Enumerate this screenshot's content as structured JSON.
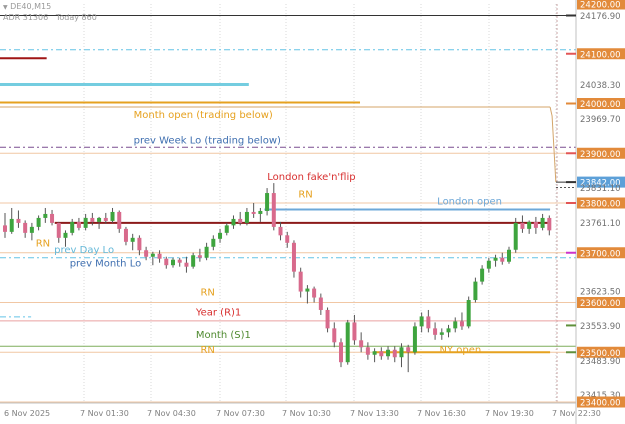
{
  "header": {
    "symbol": "DE40,M15",
    "adr": "ADR 31306",
    "today": "Today 860"
  },
  "colors": {
    "grid": "#d9d9d9",
    "sep": "#c8a6a6",
    "bull": "#3ea43e",
    "bear": "#d86a8c",
    "wick": "#555555",
    "round": "#e9a84b",
    "year": "#d96a6a",
    "month": "#5f8f3a",
    "london": "#6ea8d8",
    "ny": "#e6a11f",
    "weeklo": "#7a4e90",
    "dayblue": "#3f6fb0",
    "axisText": "#707070",
    "labelDefault": "#e28a3a"
  },
  "chart_data": {
    "type": "candlestick",
    "symbol": "DE40",
    "timeframe": "M15",
    "ylim": [
      23400,
      24200
    ],
    "price_labels": [
      {
        "label": "24200.00",
        "v": 24200,
        "bg": "#e28a3a",
        "fg": "#ffffff",
        "tick": ""
      },
      {
        "label": "24176.90",
        "v": 24176.9,
        "bg": "",
        "fg": "#707070",
        "tick": "#333333"
      },
      {
        "label": "24100.00",
        "v": 24100,
        "bg": "#e28a3a",
        "fg": "#ffffff",
        "tick": "#e25555"
      },
      {
        "label": "24038.30",
        "v": 24038.3,
        "bg": "",
        "fg": "#707070",
        "tick": ""
      },
      {
        "label": "24000.00",
        "v": 24000,
        "bg": "#e28a3a",
        "fg": "#ffffff",
        "tick": "#e28a3a"
      },
      {
        "label": "23969.70",
        "v": 23969.7,
        "bg": "",
        "fg": "#707070",
        "tick": ""
      },
      {
        "label": "23900.00",
        "v": 23900,
        "bg": "#e28a3a",
        "fg": "#ffffff",
        "tick": "#e25555"
      },
      {
        "label": "23842.00",
        "v": 23842,
        "bg": "#5da0d8",
        "fg": "#ffffff",
        "tick": "#333333"
      },
      {
        "label": "23831.10",
        "v": 23831.1,
        "bg": "",
        "fg": "#707070",
        "tick": ""
      },
      {
        "label": "23800.00",
        "v": 23800,
        "bg": "#e28a3a",
        "fg": "#ffffff",
        "tick": "#e25555"
      },
      {
        "label": "23761.10",
        "v": 23761.1,
        "bg": "",
        "fg": "#707070",
        "tick": ""
      },
      {
        "label": "23700.00",
        "v": 23700,
        "bg": "#e28a3a",
        "fg": "#ffffff",
        "tick": "#cc33cc"
      },
      {
        "label": "23623.50",
        "v": 23623.5,
        "bg": "",
        "fg": "#707070",
        "tick": ""
      },
      {
        "label": "23600.00",
        "v": 23600,
        "bg": "#e28a3a",
        "fg": "#ffffff",
        "tick": ""
      },
      {
        "label": "23553.90",
        "v": 23553.9,
        "bg": "",
        "fg": "#707070",
        "tick": "#5f8f3a"
      },
      {
        "label": "23500.00",
        "v": 23500,
        "bg": "#e28a3a",
        "fg": "#ffffff",
        "tick": "#5f8f3a"
      },
      {
        "label": "23483.90",
        "v": 23483.9,
        "bg": "",
        "fg": "#707070",
        "tick": ""
      },
      {
        "label": "23415.30",
        "v": 23415.3,
        "bg": "",
        "fg": "#707070",
        "tick": ""
      },
      {
        "label": "23400.00",
        "v": 23400,
        "bg": "#e28a3a",
        "fg": "#ffffff",
        "tick": ""
      }
    ],
    "time_labels": [
      "6 Nov 2025",
      "7 Nov 01:30",
      "7 Nov 04:30",
      "7 Nov 07:30",
      "7 Nov 10:30",
      "7 Nov 13:30",
      "7 Nov 16:30",
      "7 Nov 19:30",
      "7 Nov 22:30"
    ],
    "levels": [
      {
        "name": "24176.90",
        "v": 24176.9,
        "x0": 0.0,
        "x1": 1.0,
        "color": "#333333",
        "dash": "",
        "w": 1
      },
      {
        "name": "blue-dashdot-upper",
        "v": 24108,
        "x0": 0.0,
        "x1": 1.0,
        "color": "#63c3e6",
        "dash": "6,3,2,3",
        "w": 1
      },
      {
        "name": "dark-red-short",
        "v": 24091,
        "x0": 0.0,
        "x1": 0.081,
        "color": "#a01515",
        "dash": "",
        "w": 2
      },
      {
        "name": "cyan-short",
        "v": 24038.3,
        "x0": 0.0,
        "x1": 0.432,
        "color": "#74cde0",
        "dash": "",
        "w": 3
      },
      {
        "name": "orange-short",
        "v": 24002,
        "x0": 0.0,
        "x1": 0.625,
        "color": "#e6a11f",
        "dash": "",
        "w": 2
      },
      {
        "name": "month-open",
        "v": 23993,
        "x0": 0.0,
        "x1": 0.955,
        "color": "#d4a56a",
        "dash": "",
        "w": 1
      },
      {
        "name": "prev-week-lo",
        "v": 23912,
        "x0": 0.0,
        "x1": 1.0,
        "color": "#7a4e90",
        "dash": "6,3,2,3",
        "w": 1
      },
      {
        "name": "rn-23900",
        "v": 23900,
        "x0": 0.0,
        "x1": 1.0,
        "color": "#f1c7a4",
        "dash": "",
        "w": 1
      },
      {
        "name": "rn-23800",
        "v": 23800,
        "x0": 0.0,
        "x1": 1.0,
        "color": "#f1c7a4",
        "dash": "",
        "w": 1
      },
      {
        "name": "london-open",
        "v": 23787,
        "x0": 0.459,
        "x1": 0.955,
        "color": "#6ea8d8",
        "dash": "",
        "w": 2
      },
      {
        "name": "london-fakeflip",
        "v": 23760,
        "x0": 0.095,
        "x1": 0.955,
        "color": "#8b1a1a",
        "dash": "",
        "w": 2
      },
      {
        "name": "rn-23700",
        "v": 23700,
        "x0": 0.0,
        "x1": 1.0,
        "color": "#f1c7a4",
        "dash": "",
        "w": 1
      },
      {
        "name": "prev-day-month-lo",
        "v": 23690,
        "x0": 0.0,
        "x1": 1.0,
        "color": "#63c3e6",
        "dash": "6,3,2,3",
        "w": 1
      },
      {
        "name": "rn-23600",
        "v": 23600,
        "x0": 0.0,
        "x1": 1.0,
        "color": "#f1c7a4",
        "dash": "",
        "w": 1
      },
      {
        "name": "blue-dashdot-lower",
        "v": 23571,
        "x0": 0.0,
        "x1": 0.054,
        "color": "#63c3e6",
        "dash": "6,3,2,3",
        "w": 1
      },
      {
        "name": "year-r1",
        "v": 23563,
        "x0": 0.0,
        "x1": 1.0,
        "color": "#e9a0a0",
        "dash": "",
        "w": 1
      },
      {
        "name": "month-s1",
        "v": 23512,
        "x0": 0.0,
        "x1": 1.0,
        "color": "#7fae5c",
        "dash": "",
        "w": 1
      },
      {
        "name": "rn-23500",
        "v": 23500,
        "x0": 0.0,
        "x1": 1.0,
        "color": "#f1c7a4",
        "dash": "",
        "w": 1
      },
      {
        "name": "ny-open",
        "v": 23500,
        "x0": 0.649,
        "x1": 0.955,
        "color": "#e6a11f",
        "dash": "",
        "w": 2
      },
      {
        "name": "rn-23400",
        "v": 23400,
        "x0": 0.0,
        "x1": 1.0,
        "color": "#f1c7a4",
        "dash": "",
        "w": 1
      }
    ],
    "annotations": [
      {
        "text": "Month open   (trading below)",
        "v": 23965,
        "x": 0.232,
        "color": "#e6a11f"
      },
      {
        "text": "prev Week Lo   (trading below)",
        "v": 23914,
        "x": 0.232,
        "color": "#3f6fb0"
      },
      {
        "text": "London fake'n'flip",
        "v": 23840,
        "x": 0.464,
        "color": "#d83030"
      },
      {
        "text": "RN",
        "v": 23805,
        "x": 0.518,
        "color": "#e6a11f"
      },
      {
        "text": "London open",
        "v": 23791,
        "x": 0.759,
        "color": "#6ea8d8"
      },
      {
        "text": "RN",
        "v": 23707,
        "x": 0.062,
        "color": "#e6a11f"
      },
      {
        "text": "prev Day Lo",
        "v": 23693,
        "x": 0.094,
        "color": "#63b8d8"
      },
      {
        "text": "prev Month Lo",
        "v": 23666,
        "x": 0.121,
        "color": "#3f6fb0"
      },
      {
        "text": "RN",
        "v": 23608,
        "x": 0.348,
        "color": "#e6a11f"
      },
      {
        "text": "Year (R)1",
        "v": 23568,
        "x": 0.34,
        "color": "#d83030"
      },
      {
        "text": "Month (S)1",
        "v": 23523,
        "x": 0.34,
        "color": "#4f8a30"
      },
      {
        "text": "RN",
        "v": 23492,
        "x": 0.348,
        "color": "#e6a11f"
      },
      {
        "text": "NY open",
        "v": 23492,
        "x": 0.763,
        "color": "#e6a11f"
      }
    ],
    "candles": [
      [
        23755,
        23780,
        23730,
        23742
      ],
      [
        23742,
        23790,
        23738,
        23768
      ],
      [
        23768,
        23785,
        23750,
        23760
      ],
      [
        23760,
        23765,
        23730,
        23740
      ],
      [
        23740,
        23760,
        23725,
        23752
      ],
      [
        23752,
        23775,
        23745,
        23770
      ],
      [
        23770,
        23790,
        23760,
        23778
      ],
      [
        23778,
        23786,
        23755,
        23760
      ],
      [
        23760,
        23762,
        23720,
        23730
      ],
      [
        23730,
        23745,
        23712,
        23740
      ],
      [
        23740,
        23768,
        23735,
        23762
      ],
      [
        23762,
        23770,
        23745,
        23750
      ],
      [
        23750,
        23778,
        23745,
        23770
      ],
      [
        23770,
        23780,
        23755,
        23762
      ],
      [
        23762,
        23772,
        23748,
        23770
      ],
      [
        23770,
        23780,
        23758,
        23764
      ],
      [
        23764,
        23790,
        23760,
        23782
      ],
      [
        23782,
        23785,
        23740,
        23748
      ],
      [
        23748,
        23752,
        23715,
        23722
      ],
      [
        23722,
        23738,
        23705,
        23730
      ],
      [
        23730,
        23735,
        23695,
        23705
      ],
      [
        23705,
        23712,
        23685,
        23692
      ],
      [
        23692,
        23702,
        23675,
        23698
      ],
      [
        23698,
        23705,
        23680,
        23688
      ],
      [
        23688,
        23692,
        23668,
        23675
      ],
      [
        23675,
        23690,
        23670,
        23686
      ],
      [
        23686,
        23690,
        23672,
        23680
      ],
      [
        23680,
        23692,
        23660,
        23672
      ],
      [
        23672,
        23700,
        23668,
        23695
      ],
      [
        23695,
        23708,
        23682,
        23690
      ],
      [
        23690,
        23720,
        23685,
        23712
      ],
      [
        23712,
        23735,
        23705,
        23728
      ],
      [
        23728,
        23748,
        23720,
        23740
      ],
      [
        23740,
        23760,
        23735,
        23755
      ],
      [
        23755,
        23775,
        23748,
        23768
      ],
      [
        23768,
        23782,
        23755,
        23760
      ],
      [
        23760,
        23790,
        23755,
        23782
      ],
      [
        23782,
        23800,
        23770,
        23778
      ],
      [
        23778,
        23790,
        23762,
        23784
      ],
      [
        23784,
        23830,
        23775,
        23820
      ],
      [
        23820,
        23840,
        23745,
        23752
      ],
      [
        23752,
        23762,
        23725,
        23735
      ],
      [
        23735,
        23742,
        23710,
        23720
      ],
      [
        23720,
        23725,
        23650,
        23662
      ],
      [
        23662,
        23670,
        23610,
        23622
      ],
      [
        23622,
        23635,
        23598,
        23628
      ],
      [
        23628,
        23632,
        23600,
        23610
      ],
      [
        23610,
        23618,
        23575,
        23585
      ],
      [
        23585,
        23590,
        23540,
        23548
      ],
      [
        23548,
        23560,
        23510,
        23520
      ],
      [
        23520,
        23528,
        23470,
        23480
      ],
      [
        23480,
        23565,
        23475,
        23560
      ],
      [
        23560,
        23575,
        23515,
        23524
      ],
      [
        23524,
        23540,
        23500,
        23510
      ],
      [
        23510,
        23520,
        23485,
        23495
      ],
      [
        23495,
        23508,
        23480,
        23502
      ],
      [
        23502,
        23510,
        23485,
        23492
      ],
      [
        23492,
        23512,
        23485,
        23505
      ],
      [
        23505,
        23512,
        23480,
        23490
      ],
      [
        23490,
        23518,
        23470,
        23510
      ],
      [
        23510,
        23515,
        23460,
        23500
      ],
      [
        23500,
        23560,
        23495,
        23552
      ],
      [
        23552,
        23580,
        23540,
        23572
      ],
      [
        23572,
        23585,
        23540,
        23548
      ],
      [
        23548,
        23560,
        23525,
        23535
      ],
      [
        23535,
        23548,
        23525,
        23540
      ],
      [
        23540,
        23555,
        23530,
        23548
      ],
      [
        23548,
        23570,
        23540,
        23562
      ],
      [
        23562,
        23580,
        23545,
        23552
      ],
      [
        23552,
        23612,
        23548,
        23605
      ],
      [
        23605,
        23650,
        23600,
        23642
      ],
      [
        23642,
        23675,
        23636,
        23668
      ],
      [
        23668,
        23690,
        23660,
        23684
      ],
      [
        23684,
        23696,
        23672,
        23690
      ],
      [
        23690,
        23700,
        23676,
        23682
      ],
      [
        23682,
        23712,
        23678,
        23706
      ],
      [
        23706,
        23770,
        23700,
        23760
      ],
      [
        23760,
        23775,
        23740,
        23748
      ],
      [
        23748,
        23765,
        23738,
        23762
      ],
      [
        23762,
        23772,
        23738,
        23750
      ],
      [
        23750,
        23778,
        23745,
        23770
      ],
      [
        23770,
        23775,
        23735,
        23745
      ]
    ]
  }
}
